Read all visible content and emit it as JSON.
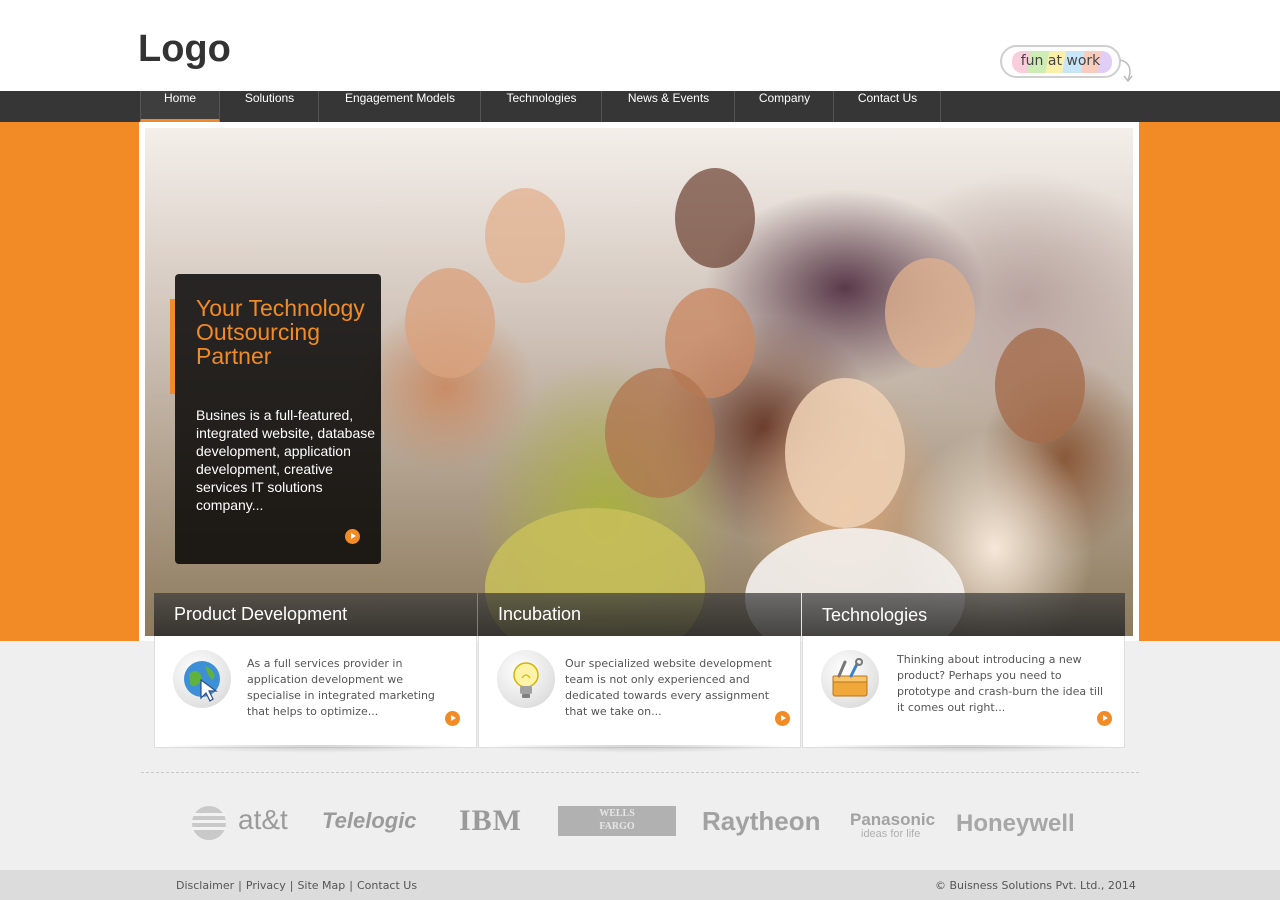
{
  "header": {
    "logo": "Logo",
    "badge": "fun at work"
  },
  "nav": {
    "items": [
      "Home",
      "Solutions",
      "Engagement Models",
      "Technologies",
      "News & Events",
      "Company",
      "Contact Us"
    ],
    "active": "Home"
  },
  "hero": {
    "title": "Your Technology Outsourcing Partner",
    "text": "Busines is a full-featured, integrated website, database development, application development, creative services IT solutions company..."
  },
  "features": [
    {
      "title": "Product Development",
      "icon": "globe-cursor-icon",
      "text": "As a full services provider in application development we specialise in integrated marketing that helps to optimize..."
    },
    {
      "title": "Incubation",
      "icon": "lightbulb-icon",
      "text": "Our specialized website development team is not only experienced and dedicated towards every assignment that we take on..."
    },
    {
      "title": "Technologies",
      "icon": "toolbox-icon",
      "text": "Thinking about introducing a new product? Perhaps you need to prototype and crash-burn the idea till it comes out right..."
    }
  ],
  "clients": {
    "att": "at&t",
    "telelogic": "Telelogic",
    "ibm": "IBM",
    "wells_fargo": "WELLS FARGO",
    "raytheon": "Raytheon",
    "panasonic": "Panasonic",
    "panasonic_tagline": "ideas for life",
    "honeywell": "Honeywell"
  },
  "footer": {
    "links": [
      "Disclaimer",
      "Privacy",
      "Site Map",
      "Contact Us"
    ],
    "copyright": "© Buisness Solutions Pvt. Ltd., 2014"
  },
  "colors": {
    "accent": "#f28a26",
    "nav_bg": "#363636",
    "page_bg": "#efefef"
  }
}
